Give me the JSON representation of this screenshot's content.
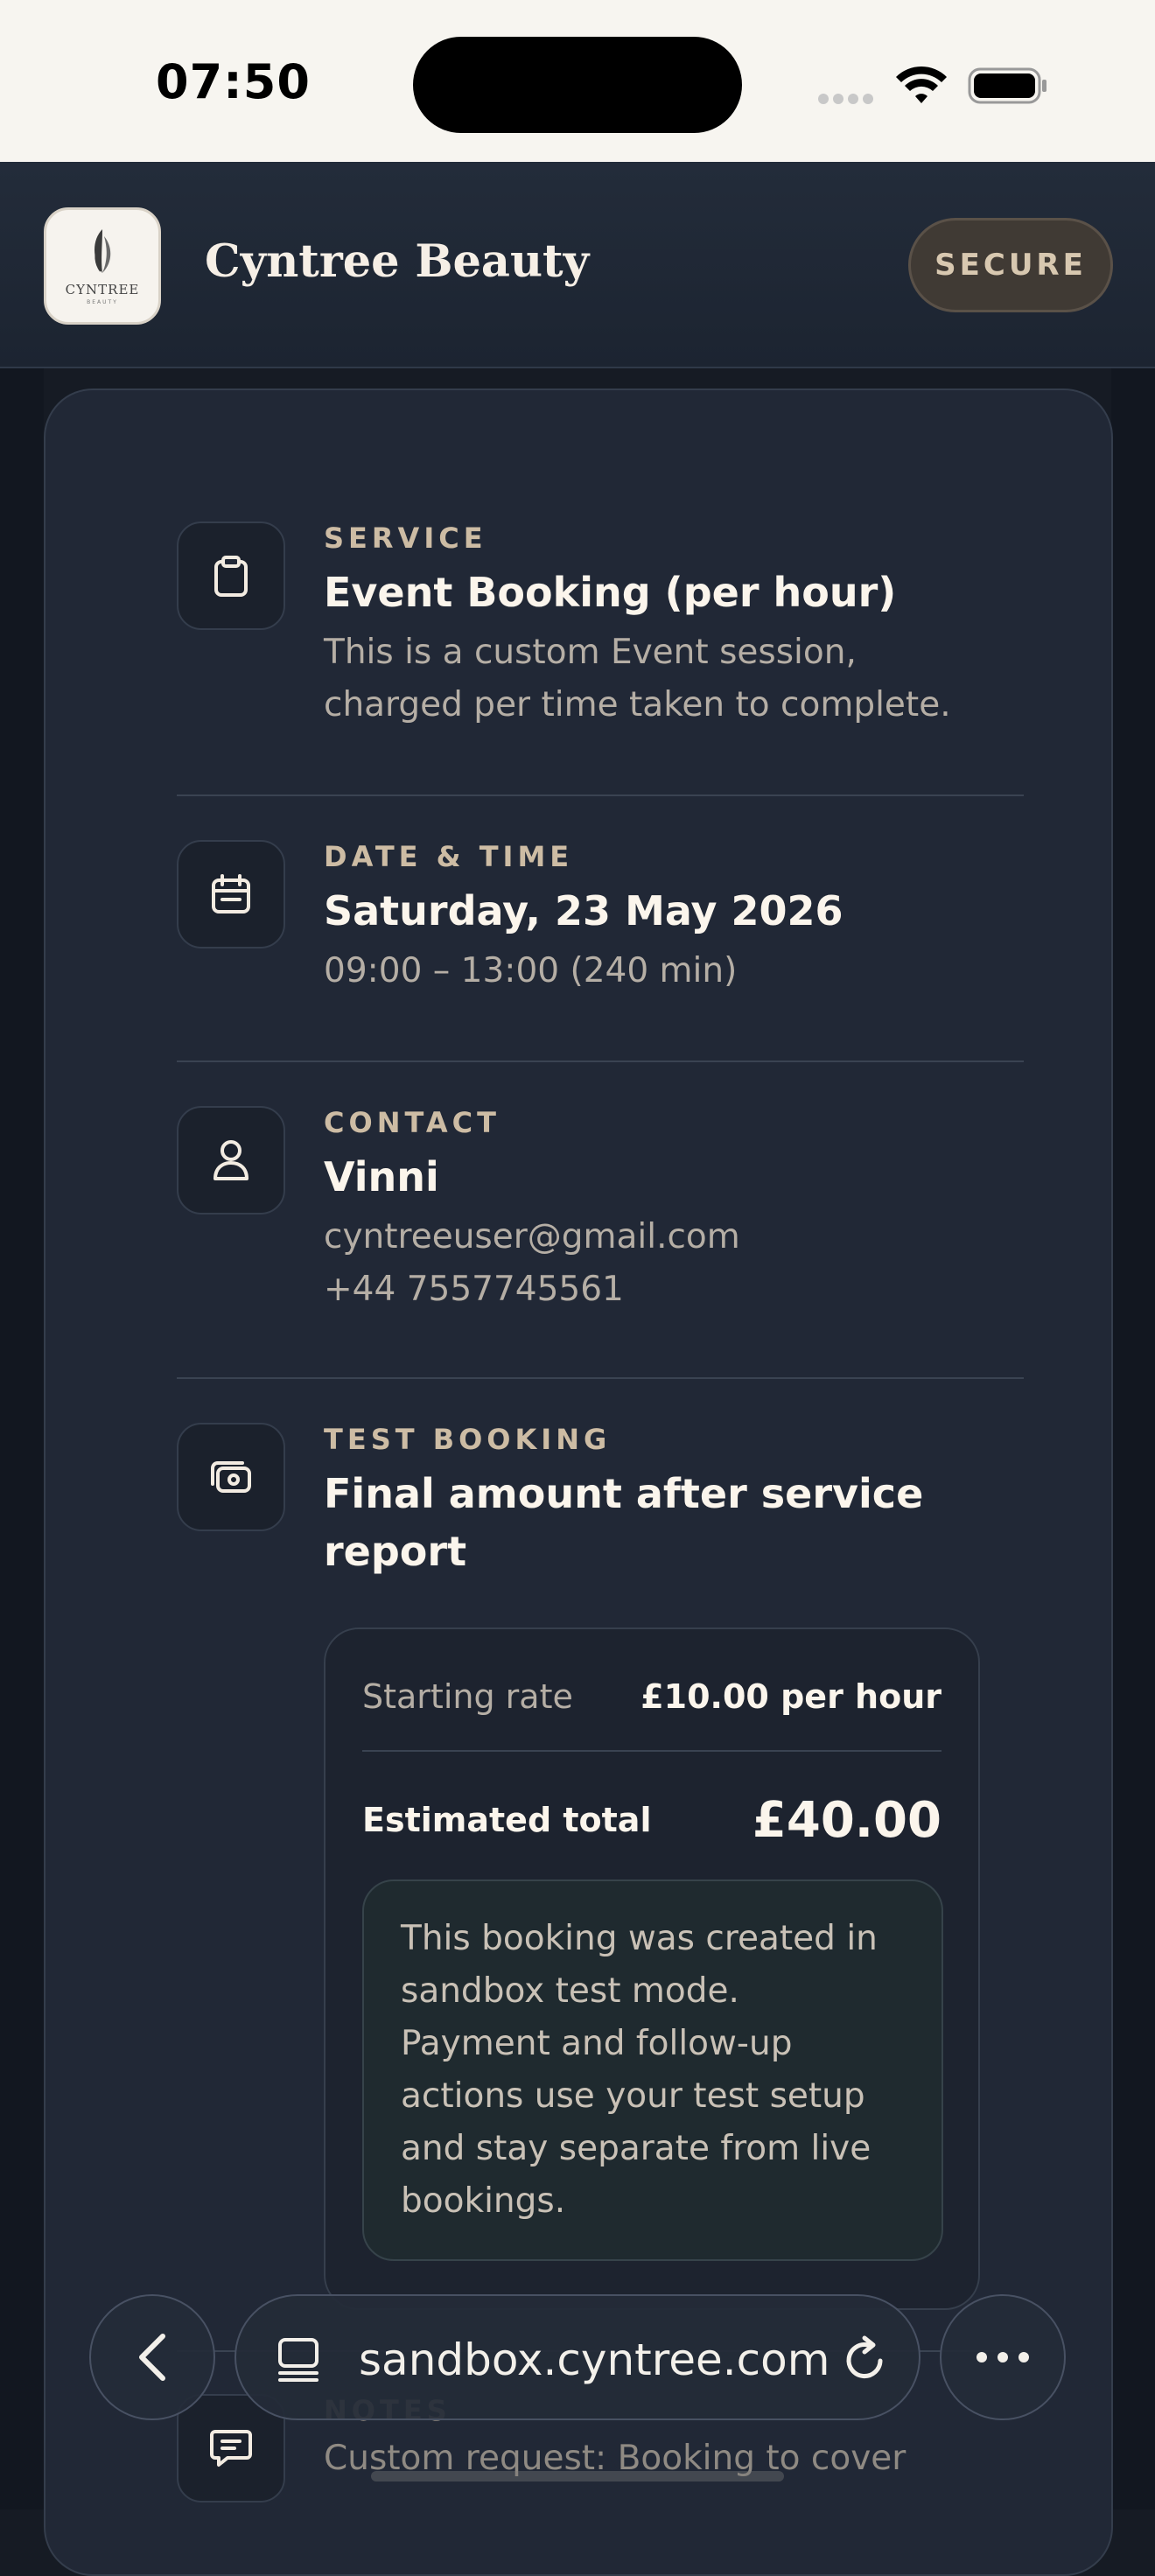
{
  "status_bar": {
    "time": "07:50"
  },
  "header": {
    "logo_text": "CYNTREE",
    "logo_subtext": "BEAUTY",
    "brand_name": "Cyntree Beauty",
    "badge": "SECURE"
  },
  "sections": {
    "service": {
      "eyebrow": "SERVICE",
      "title": "Event Booking (per hour)",
      "desc_line1": "This is a custom Event session,",
      "desc_line2": "charged per time taken to complete.",
      "icon": "clipboard-icon"
    },
    "datetime": {
      "eyebrow": "DATE & TIME",
      "title": "Saturday, 23 May 2026",
      "desc": "09:00 – 13:00 (240 min)",
      "icon": "calendar-icon"
    },
    "contact": {
      "eyebrow": "CONTACT",
      "title": "Vinni",
      "email": "cyntreeuser@gmail.com",
      "phone": "+44 7557745561",
      "icon": "user-icon"
    },
    "test_booking": {
      "eyebrow": "TEST BOOKING",
      "title_line1": "Final amount after service",
      "title_line2": "report",
      "icon": "cash-icon",
      "starting_rate_label": "Starting rate",
      "starting_rate_value": "£10.00 per hour",
      "estimated_total_label": "Estimated total",
      "estimated_total_value": "£40.00",
      "note_lines": [
        "This booking was created in",
        "sandbox test mode.",
        "Payment and follow-up",
        "actions use your test setup",
        "and stay separate from live",
        "bookings."
      ]
    },
    "notes": {
      "eyebrow": "NOTES",
      "text": "Custom request: Booking to cover",
      "icon": "message-icon"
    }
  },
  "browser": {
    "url": "sandbox.cyntree.com"
  },
  "colors": {
    "background": "#161b24",
    "card": "#212836",
    "accent": "#cdbca4",
    "text": "#fbf5ec"
  }
}
